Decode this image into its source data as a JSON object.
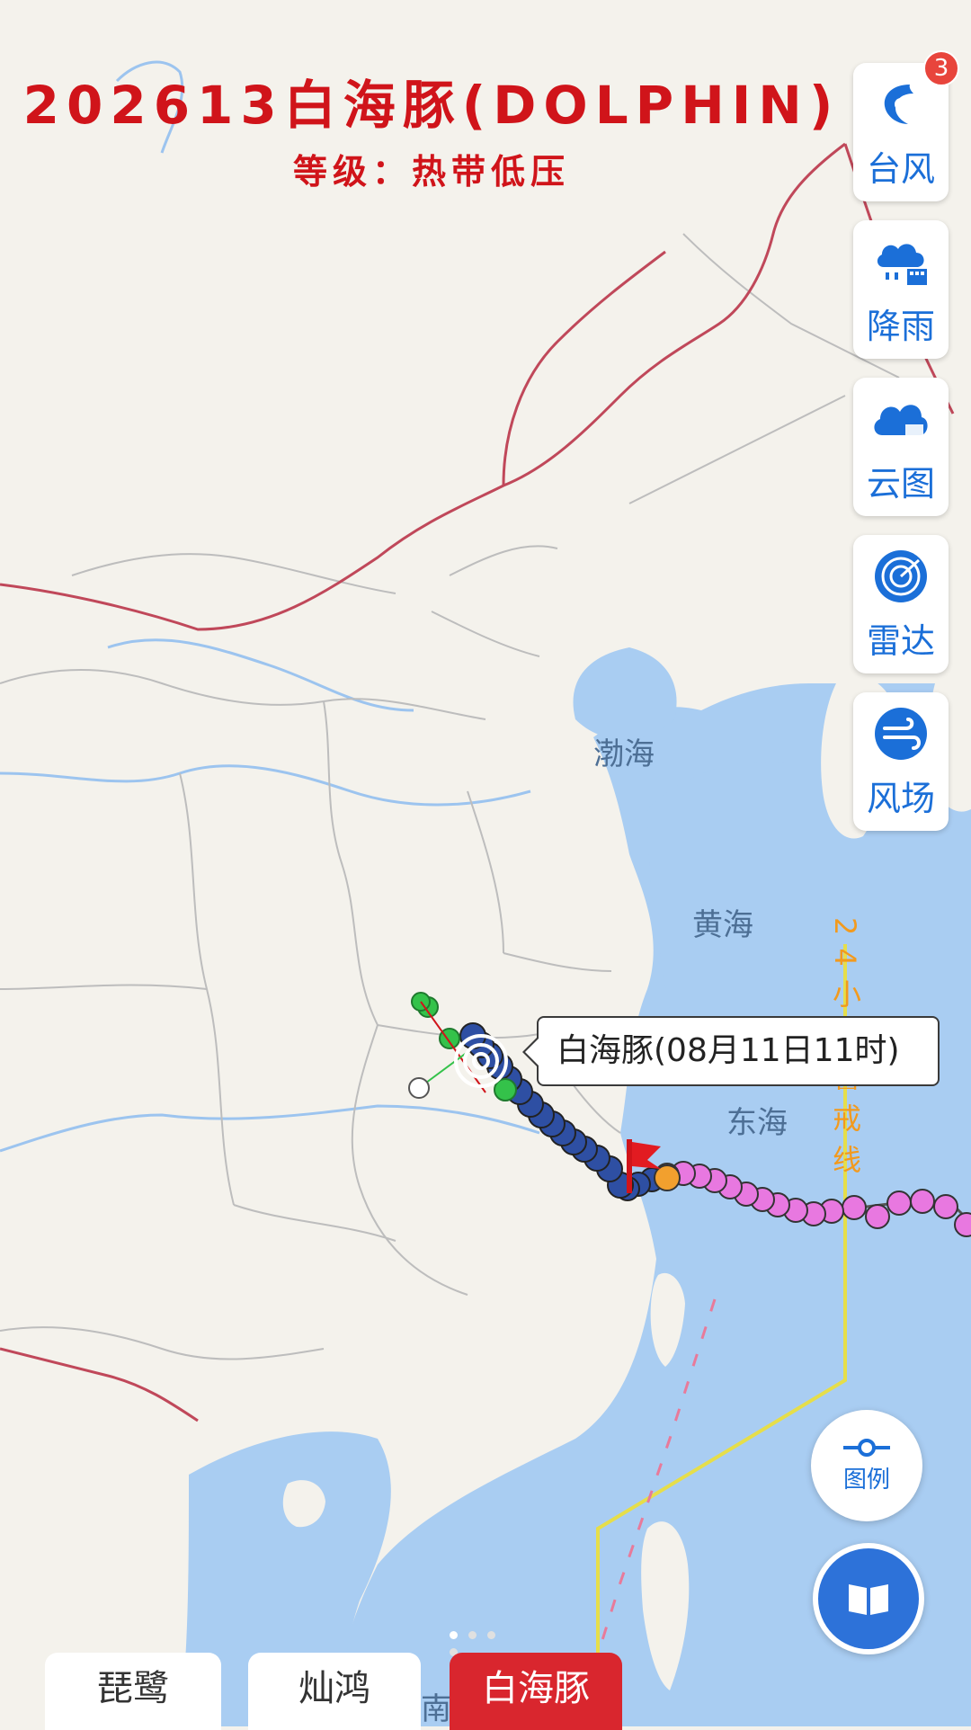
{
  "header": {
    "title": "202613白海豚(DOLPHIN)",
    "level": "等级：热带低压"
  },
  "side_menu": {
    "badge": "3",
    "items": [
      {
        "label": "台风",
        "icon": "typhoon-icon"
      },
      {
        "label": "降雨",
        "icon": "rain-icon"
      },
      {
        "label": "云图",
        "icon": "cloud-icon"
      },
      {
        "label": "雷达",
        "icon": "radar-icon"
      },
      {
        "label": "风场",
        "icon": "wind-icon"
      }
    ]
  },
  "map": {
    "sea_labels": [
      "渤海",
      "黄海",
      "东海",
      "南"
    ],
    "warning_line_text": "24小时警戒线",
    "typhoon_label": "白海豚(08月11日11时)",
    "colors": {
      "land": "#f4f2ec",
      "sea": "#a9cdf2",
      "province_border": "#bdbdbd",
      "country_border": "#c0485a",
      "warning_line": "#e6de4a",
      "warning_text": "#f29a1e",
      "track_tropical_depression": "#2e4fa3",
      "track_forecast": "#34c24a",
      "track_strong_typhoon": "#e878e0",
      "track_tropical_storm": "#f2a02e"
    }
  },
  "legend_button": {
    "label": "图例",
    "icon": "legend-icon"
  },
  "guide_button": {
    "icon": "book-icon"
  },
  "tabs": [
    {
      "label": "琵鹭",
      "active": false
    },
    {
      "label": "灿鸿",
      "active": false
    },
    {
      "label": "白海豚",
      "active": true
    }
  ]
}
